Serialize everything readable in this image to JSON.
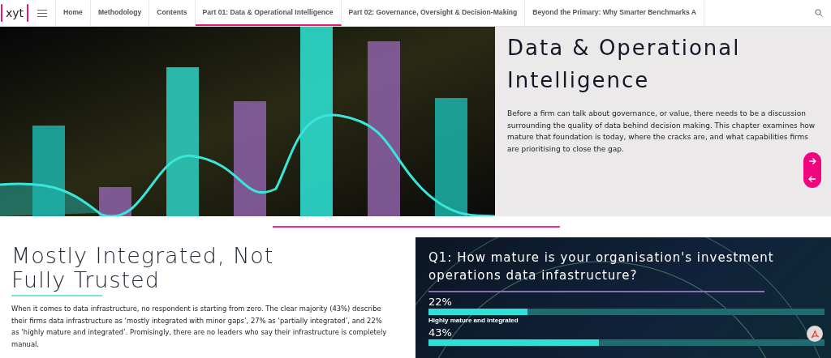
{
  "logo": "xyt",
  "nav": {
    "tabs": [
      {
        "label": "Home",
        "selected": false
      },
      {
        "label": "Methodology",
        "selected": false
      },
      {
        "label": "Contents",
        "selected": false
      },
      {
        "label": "Part 01: Data & Operational Intelligence",
        "selected": true
      },
      {
        "label": "Part 02: Governance, Oversight & Decision-Making",
        "selected": false
      },
      {
        "label": "Beyond the Primary: Why Smarter Benchmarks A",
        "selected": false
      }
    ]
  },
  "hero": {
    "title": "Data & Operational Intelligence",
    "text": "Before a firm can talk about governance, or value, there needs to be a discussion surrounding the quality of data behind decision making. This chapter examines how mature that foundation is today, where the cracks are, and what capabilities firms are prioritising to close the gap."
  },
  "section": {
    "title": "Mostly Integrated, Not Fully Trusted",
    "text": "When it comes to data infrastructure, no respondent is starting from zero. The clear majority (43%) describe their firms data infrastructure as ‘mostly integrated with minor gaps’, 27% as ‘partially integrated’, and 22% as ‘highly mature and integrated’. Promisingly, there are no leaders who say their infrastructure is completely manual."
  },
  "poll": {
    "question": "Q1: How mature is your organisation's investment operations data infastructure?",
    "answers": [
      {
        "percent": "22%",
        "level": 0.25,
        "label": "Highly mature and integrated"
      },
      {
        "percent": "43%",
        "level": 0.43
      }
    ]
  }
}
